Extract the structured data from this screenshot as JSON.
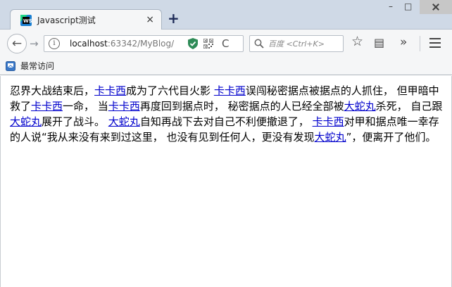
{
  "window": {
    "tab_title": "Javascript测试",
    "tab_close": "×",
    "new_tab": "+",
    "minimize": "–",
    "maximize": "□",
    "icons": [
      "webstorm-icon",
      "close-icon",
      "plus-icon",
      "back-arrow-icon",
      "forward-arrow-icon",
      "info-icon",
      "shield-icon",
      "qr-code-icon",
      "reload-icon",
      "search-icon",
      "star-icon",
      "reading-list-icon",
      "overflow-icon",
      "hamburger-menu-icon",
      "bookmark-folder-icon"
    ]
  },
  "navbar": {
    "back": "←",
    "forward": "→",
    "url_host": "localhost",
    "url_rest": ":63342/MyBlog/",
    "reload": "C",
    "search_placeholder": "百度 <Ctrl+K>",
    "star": "☆",
    "reading_list": "▤",
    "overflow": "»"
  },
  "bookmarks": {
    "label": "最常访问"
  },
  "article": {
    "segments": [
      {
        "t": "忍界大战结束后，"
      },
      {
        "t": "卡卡西",
        "link": true
      },
      {
        "t": "成为了六代目火影 "
      },
      {
        "t": "卡卡西",
        "link": true
      },
      {
        "t": "误闯秘密据点被据点的人抓住， 但甲暗中救了"
      },
      {
        "t": "卡卡西",
        "link": true
      },
      {
        "t": "一命， 当"
      },
      {
        "t": "卡卡西",
        "link": true
      },
      {
        "t": "再度回到据点时， 秘密据点的人已经全部被"
      },
      {
        "t": "大蛇丸",
        "link": true
      },
      {
        "t": "杀死， 自己跟"
      },
      {
        "t": "大蛇丸",
        "link": true
      },
      {
        "t": "展开了战斗。 "
      },
      {
        "t": "大蛇丸",
        "link": true
      },
      {
        "t": "自知再战下去对自己不利便撤退了， "
      },
      {
        "t": "卡卡西",
        "link": true
      },
      {
        "t": "对甲和据点唯一幸存的人说“我从来没有来到过这里， 也没有见到任何人，更没有发现"
      },
      {
        "t": "大蛇丸",
        "link": true
      },
      {
        "t": "”，便离开了他们。"
      }
    ]
  },
  "colors": {
    "link": "#0000cc",
    "tabstrip": "#cfd9e6",
    "toolbar": "#f5f6f7",
    "shield": "#2e8b57"
  }
}
